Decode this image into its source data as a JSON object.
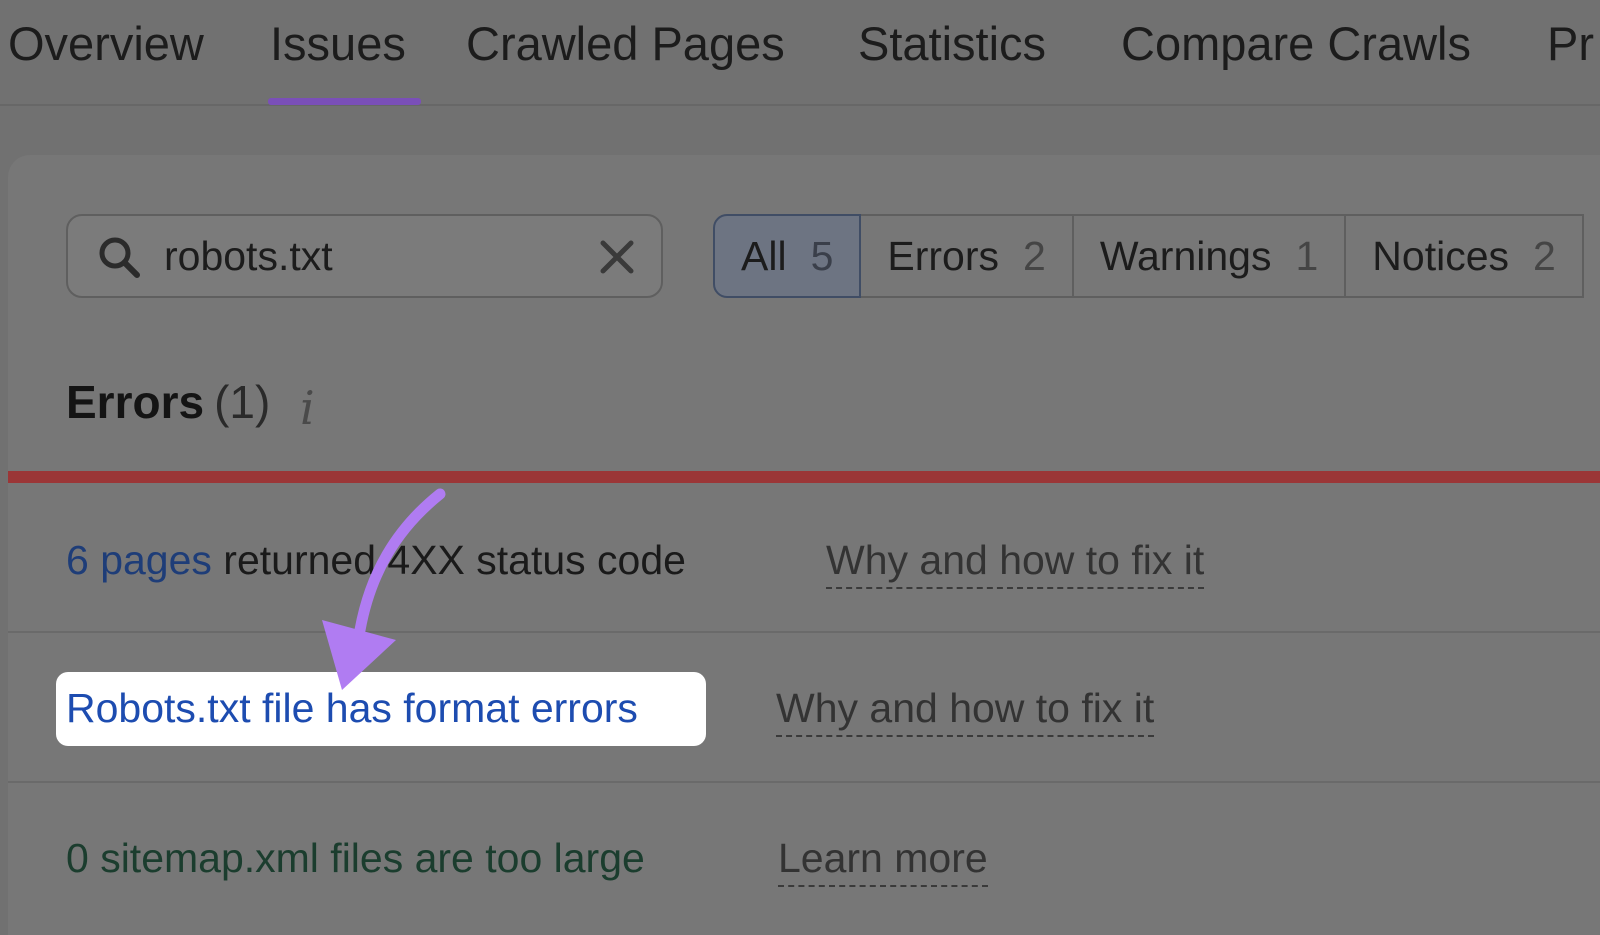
{
  "tabs": [
    {
      "label": "Overview",
      "active": false
    },
    {
      "label": "Issues",
      "active": true
    },
    {
      "label": "Crawled Pages",
      "active": false
    },
    {
      "label": "Statistics",
      "active": false
    },
    {
      "label": "Compare Crawls",
      "active": false
    },
    {
      "label": "Pr",
      "active": false
    }
  ],
  "search": {
    "value": "robots.txt"
  },
  "filters": [
    {
      "label": "All",
      "count": "5",
      "active": true
    },
    {
      "label": "Errors",
      "count": "2",
      "active": false
    },
    {
      "label": "Warnings",
      "count": "1",
      "active": false
    },
    {
      "label": "Notices",
      "count": "2",
      "active": false
    }
  ],
  "section": {
    "title": "Errors",
    "count": "(1)",
    "info_icon": "i"
  },
  "rows": [
    {
      "link": "6 pages",
      "text": " returned 4XX status code",
      "help": "Why and how to fix it"
    },
    {
      "link": "Robots.txt file has format errors",
      "help": "Why and how to fix it"
    },
    {
      "link": "0 sitemap.xml files are too large",
      "help": "Learn more"
    }
  ],
  "colors": {
    "accent": "#7a4fb8",
    "error_bar": "#9b3637",
    "annotation_arrow": "#b07cf2",
    "link": "#1d4cb0"
  }
}
